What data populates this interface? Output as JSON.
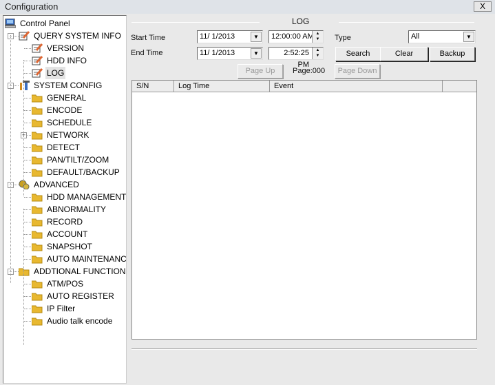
{
  "window": {
    "title": "Configuration",
    "close_label": "X"
  },
  "tree": [
    {
      "label": "Control Panel",
      "level": 0,
      "icon": "computer-icon"
    },
    {
      "label": "QUERY SYSTEM INFO",
      "level": 1,
      "icon": "notepad-pencil-icon",
      "expander": "-"
    },
    {
      "label": "VERSION",
      "level": 2,
      "icon": "notepad-pencil-icon"
    },
    {
      "label": "HDD INFO",
      "level": 2,
      "icon": "notepad-pencil-icon"
    },
    {
      "label": "LOG",
      "level": 2,
      "icon": "notepad-pencil-icon",
      "selected": true
    },
    {
      "label": "SYSTEM CONFIG",
      "level": 1,
      "icon": "tools-icon",
      "expander": "-"
    },
    {
      "label": "GENERAL",
      "level": 2,
      "icon": "folder-icon"
    },
    {
      "label": "ENCODE",
      "level": 2,
      "icon": "folder-icon"
    },
    {
      "label": "SCHEDULE",
      "level": 2,
      "icon": "folder-icon"
    },
    {
      "label": "NETWORK",
      "level": 2,
      "icon": "folder-icon",
      "expander": "+"
    },
    {
      "label": "DETECT",
      "level": 2,
      "icon": "folder-icon"
    },
    {
      "label": "PAN/TILT/ZOOM",
      "level": 2,
      "icon": "folder-icon"
    },
    {
      "label": "DEFAULT/BACKUP",
      "level": 2,
      "icon": "folder-icon"
    },
    {
      "label": "ADVANCED",
      "level": 1,
      "icon": "gears-icon",
      "expander": "-"
    },
    {
      "label": "HDD MANAGEMENT",
      "level": 2,
      "icon": "folder-icon"
    },
    {
      "label": "ABNORMALITY",
      "level": 2,
      "icon": "folder-icon"
    },
    {
      "label": "RECORD",
      "level": 2,
      "icon": "folder-icon"
    },
    {
      "label": "ACCOUNT",
      "level": 2,
      "icon": "folder-icon"
    },
    {
      "label": "SNAPSHOT",
      "level": 2,
      "icon": "folder-icon"
    },
    {
      "label": "AUTO MAINTENANCE",
      "level": 2,
      "icon": "folder-icon"
    },
    {
      "label": "ADDTIONAL FUNCTION",
      "level": 1,
      "icon": "folder-icon",
      "expander": "-"
    },
    {
      "label": "ATM/POS",
      "level": 2,
      "icon": "folder-icon"
    },
    {
      "label": "AUTO REGISTER",
      "level": 2,
      "icon": "folder-icon"
    },
    {
      "label": "IP Filter",
      "level": 2,
      "icon": "folder-icon"
    },
    {
      "label": "Audio talk encode",
      "level": 2,
      "icon": "folder-icon"
    }
  ],
  "log": {
    "heading": "LOG",
    "start_time_label": "Start Time",
    "start_date": "11/ 1/2013",
    "start_time": "12:00:00 AM",
    "end_time_label": "End Time",
    "end_date": "11/ 1/2013",
    "end_time": "2:52:25 PM",
    "type_label": "Type",
    "type_value": "All",
    "search": "Search",
    "clear": "Clear",
    "backup": "Backup",
    "page_up": "Page Up",
    "page": "Page:000",
    "page_down": "Page Down",
    "columns": [
      "S/N",
      "Log Time",
      "Event",
      ""
    ]
  },
  "colors": {
    "folder": "#e8b830",
    "selected_bg": "#e3e3e3"
  }
}
